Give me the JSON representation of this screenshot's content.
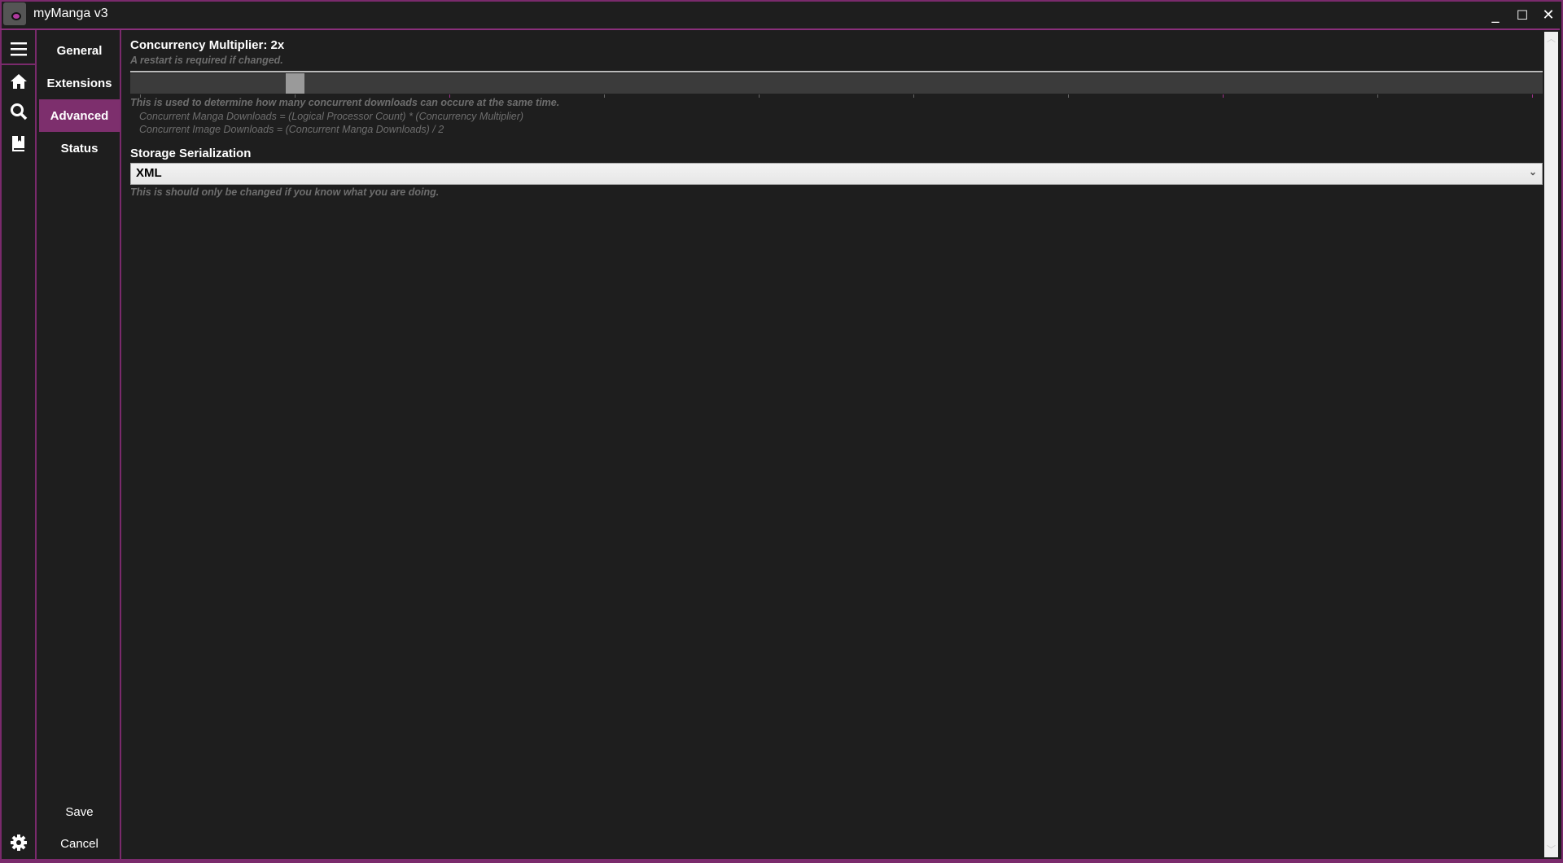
{
  "window": {
    "title": "myManga v3",
    "minimize": "_",
    "maximize": "☐",
    "close": "✕"
  },
  "colors": {
    "accent": "#7d2f6d",
    "background": "#1e1e1e",
    "track": "#3b3b3b"
  },
  "rail": {
    "icons": [
      "menu-icon",
      "home-icon",
      "search-icon",
      "library-icon",
      "gear-icon"
    ]
  },
  "nav": {
    "items": [
      {
        "label": "General"
      },
      {
        "label": "Extensions"
      },
      {
        "label": "Advanced",
        "active": true
      },
      {
        "label": "Status"
      }
    ],
    "save": "Save",
    "cancel": "Cancel"
  },
  "settings": {
    "concurrency": {
      "title": "Concurrency Multiplier: 2x",
      "note": "A restart is required if changed.",
      "slider": {
        "min": 1,
        "max": 10,
        "value": 2
      },
      "description": "This is used to determine how many concurrent downloads can occure at the same time.",
      "formula1": "Concurrent Manga Downloads = (Logical Processor Count) * (Concurrency Multiplier)",
      "formula2": "Concurrent Image Downloads = (Concurrent Manga Downloads) / 2"
    },
    "storage": {
      "title": "Storage Serialization",
      "selected": "XML",
      "note": "This is should only be changed if you know what you are doing."
    }
  }
}
